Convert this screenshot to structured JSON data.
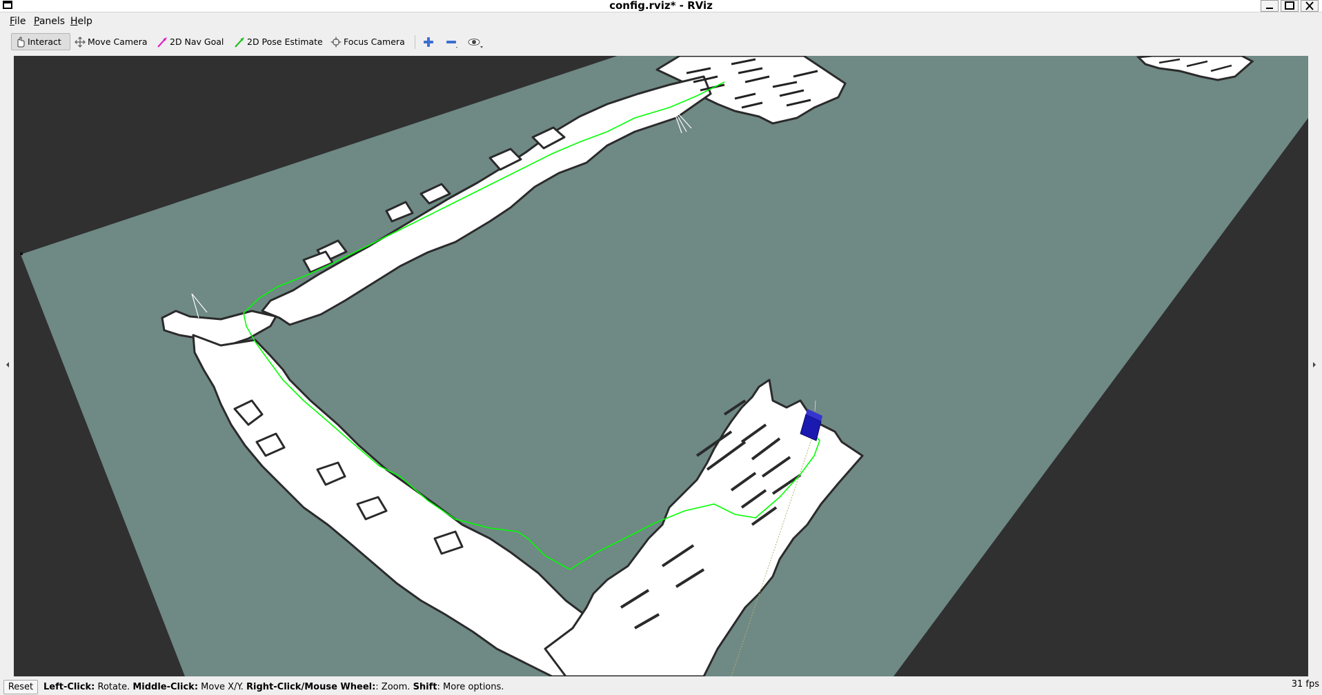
{
  "window": {
    "title": "config.rviz* - RViz",
    "controls": {
      "minimize": "_",
      "maximize": "□",
      "close": "✕"
    }
  },
  "menubar": {
    "file": {
      "mnemonic": "F",
      "rest": "ile"
    },
    "panels": {
      "mnemonic": "P",
      "rest": "anels"
    },
    "help": {
      "mnemonic": "H",
      "rest": "elp"
    }
  },
  "toolbar": {
    "tools": [
      {
        "label": "Interact",
        "icon": "hand-pointer-icon",
        "active": true
      },
      {
        "label": "Move Camera",
        "icon": "move-arrows-icon",
        "active": false
      },
      {
        "label": "2D Nav Goal",
        "icon": "magenta-arrow-icon",
        "color": "#e020c0",
        "active": false
      },
      {
        "label": "2D Pose Estimate",
        "icon": "green-arrow-icon",
        "color": "#20c020",
        "active": false
      },
      {
        "label": "Focus Camera",
        "icon": "crosshair-icon",
        "active": false
      }
    ],
    "extra_icons": [
      "add-tool-icon",
      "remove-tool-icon",
      "eye-icon"
    ]
  },
  "viewport": {
    "background": "#303030",
    "grid_plane_color": "#6f8985",
    "free_space_color": "#ffffff",
    "path_color": "#00ff00",
    "robot_color": "#1a1ab0"
  },
  "statusbar": {
    "reset_label": "Reset",
    "hint": [
      {
        "bold": "Left-Click:",
        "text": " Rotate. "
      },
      {
        "bold": "Middle-Click:",
        "text": " Move X/Y. "
      },
      {
        "bold": "Right-Click/Mouse Wheel:",
        "text": ": Zoom. "
      },
      {
        "bold": "Shift",
        "text": ": More options."
      }
    ],
    "fps": "31 fps"
  }
}
